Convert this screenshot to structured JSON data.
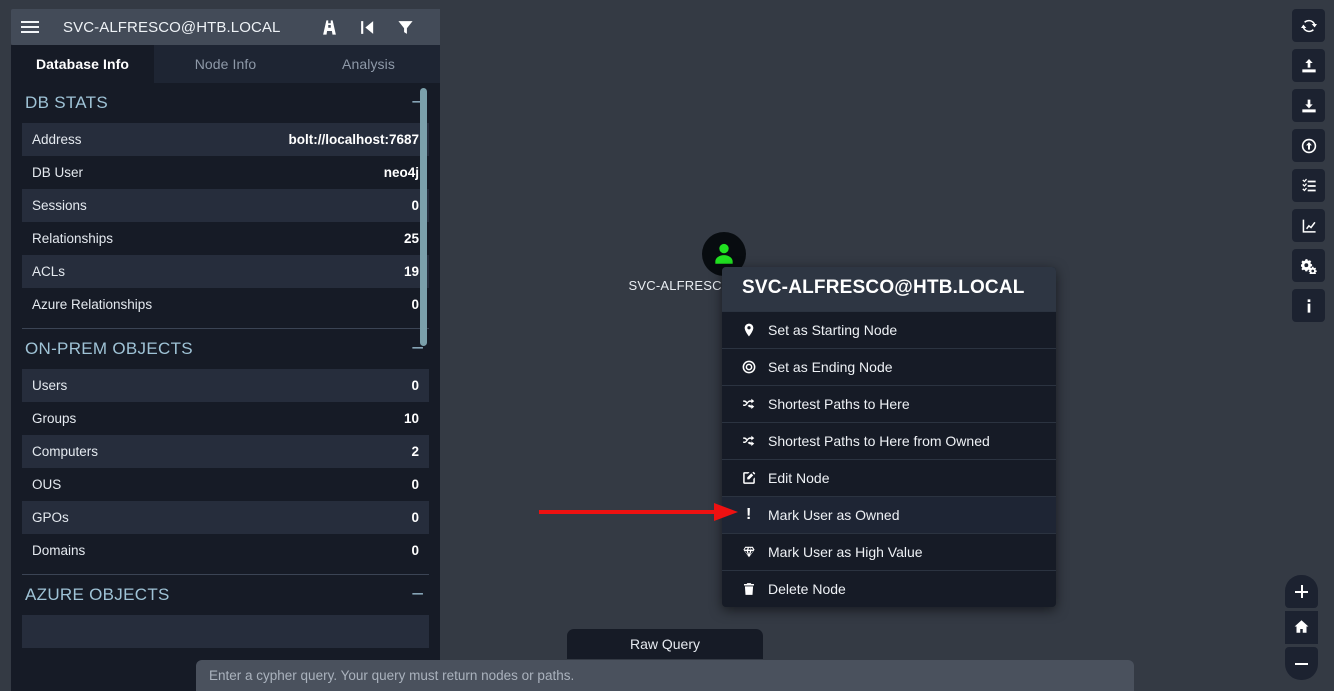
{
  "topbar": {
    "title": "SVC-ALFRESCO@HTB.LOCAL",
    "menu_icon": "hamburger-icon",
    "icons": [
      {
        "name": "pathfinding-icon",
        "label": "Pathfinding"
      },
      {
        "name": "expand-collapse-icon",
        "label": "Expand"
      },
      {
        "name": "filter-icon",
        "label": "Filter"
      }
    ]
  },
  "tabs": [
    {
      "label": "Database Info",
      "active": true
    },
    {
      "label": "Node Info",
      "active": false
    },
    {
      "label": "Analysis",
      "active": false
    }
  ],
  "panels": [
    {
      "title": "DB STATS",
      "collapse_label": "–",
      "rows": [
        {
          "label": "Address",
          "value": "bolt://localhost:7687"
        },
        {
          "label": "DB User",
          "value": "neo4j"
        },
        {
          "label": "Sessions",
          "value": "0"
        },
        {
          "label": "Relationships",
          "value": "25"
        },
        {
          "label": "ACLs",
          "value": "19"
        },
        {
          "label": "Azure Relationships",
          "value": "0"
        }
      ]
    },
    {
      "title": "ON-PREM OBJECTS",
      "collapse_label": "–",
      "rows": [
        {
          "label": "Users",
          "value": "0"
        },
        {
          "label": "Groups",
          "value": "10"
        },
        {
          "label": "Computers",
          "value": "2"
        },
        {
          "label": "OUS",
          "value": "0"
        },
        {
          "label": "GPOs",
          "value": "0"
        },
        {
          "label": "Domains",
          "value": "0"
        }
      ]
    },
    {
      "title": "AZURE OBJECTS",
      "collapse_label": "–",
      "rows": []
    }
  ],
  "graph": {
    "node_label": "SVC-ALFRESCO@HTB.LOCAL",
    "node_icon": "user-icon",
    "node_color": "#21e021"
  },
  "context_menu": {
    "header": "SVC-ALFRESCO@HTB.LOCAL",
    "items": [
      {
        "label": "Set as Starting Node",
        "icon": "map-pin-icon",
        "highlighted": false
      },
      {
        "label": "Set as Ending Node",
        "icon": "bullseye-icon",
        "highlighted": false
      },
      {
        "label": "Shortest Paths to Here",
        "icon": "shuffle-icon",
        "highlighted": false
      },
      {
        "label": "Shortest Paths to Here from Owned",
        "icon": "shuffle-icon",
        "highlighted": false
      },
      {
        "label": "Edit Node",
        "icon": "edit-pencil-icon",
        "highlighted": false
      },
      {
        "label": "Mark User as Owned",
        "icon": "exclamation-icon",
        "highlighted": true
      },
      {
        "label": "Mark User as High Value",
        "icon": "gem-icon",
        "highlighted": false
      },
      {
        "label": "Delete Node",
        "icon": "trash-icon",
        "highlighted": false
      }
    ]
  },
  "right_toolbar": [
    {
      "name": "refresh-icon",
      "label": "Refresh"
    },
    {
      "name": "upload-icon",
      "label": "Upload Data"
    },
    {
      "name": "download-icon",
      "label": "Download Data"
    },
    {
      "name": "upload-circle-icon",
      "label": "Change Layout"
    },
    {
      "name": "checklist-icon",
      "label": "Checklist"
    },
    {
      "name": "chart-icon",
      "label": "Analysis Chart"
    },
    {
      "name": "settings-gears-icon",
      "label": "Settings"
    },
    {
      "name": "info-icon",
      "label": "About"
    }
  ],
  "zoom_controls": [
    {
      "name": "zoom-in-button",
      "label": "+"
    },
    {
      "name": "home-button",
      "label": "home-icon"
    },
    {
      "name": "zoom-out-button",
      "label": "−"
    }
  ],
  "bottom": {
    "raw_query_label": "Raw Query",
    "cypher_placeholder": "Enter a cypher query. Your query must return nodes or paths.",
    "cypher_value": ""
  },
  "annotation": {
    "arrow_color": "#ee1111",
    "points_to": "Mark User as Owned"
  },
  "colors": {
    "canvas_bg": "#343a44",
    "panel_bg": "#161b26",
    "row_alt_bg": "#262d3c",
    "accent": "#9fc3d6",
    "scrollbar": "#7ba0ab"
  }
}
